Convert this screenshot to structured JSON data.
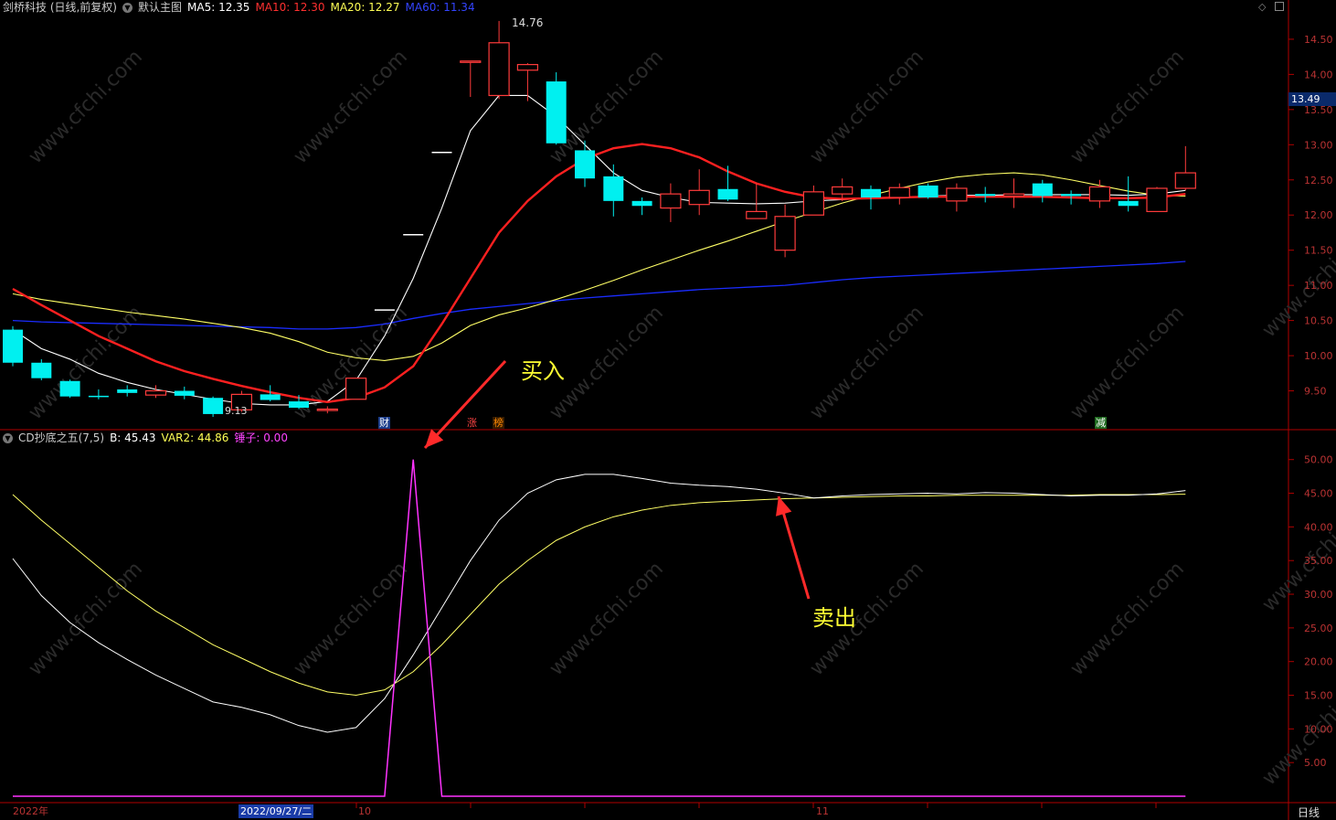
{
  "header_main": {
    "title": "剑桥科技 (日线,前复权)",
    "mode": "默认主图",
    "ma5": "MA5: 12.35",
    "ma10": "MA10: 12.30",
    "ma20": "MA20: 12.27",
    "ma60": "MA60: 11.34"
  },
  "header_sub": {
    "name": "CD抄底之五(7,5)",
    "b": "B: 45.43",
    "var2": "VAR2: 44.86",
    "hammer": "锤子: 0.00"
  },
  "current_price": "13.49",
  "annotations": {
    "buy": "买入",
    "sell": "卖出",
    "high": "14.76",
    "low": "9.13"
  },
  "event_tags": {
    "t1": "财",
    "t2": "涨",
    "t3": "榜",
    "t4": "减"
  },
  "x_axis": {
    "year": "2022年",
    "selected_date": "2022/09/27/二",
    "m10": "10",
    "m11": "11",
    "period": "日线"
  },
  "colors": {
    "up": "#ff3b3b",
    "down": "#00f0f0",
    "ma5": "#ffffff",
    "ma10": "#ff2020",
    "ma20": "#ffff66",
    "ma60": "#1a2cff",
    "b": "#ffffff",
    "var2": "#ffff66",
    "hammer": "#ff33ff",
    "axis": "#b00000"
  },
  "chart_data": [
    {
      "type": "candlestick",
      "title": "剑桥科技 (日线,前复权)",
      "y_ticks": [
        "9.50",
        "10.00",
        "10.50",
        "11.00",
        "11.50",
        "12.00",
        "12.50",
        "13.00",
        "13.50",
        "14.00",
        "14.50"
      ],
      "ylim": [
        9.0,
        14.85
      ],
      "candles": [
        {
          "o": 10.37,
          "h": 10.42,
          "l": 9.85,
          "c": 9.9
        },
        {
          "o": 9.9,
          "h": 9.95,
          "l": 9.65,
          "c": 9.68
        },
        {
          "o": 9.64,
          "h": 9.66,
          "l": 9.4,
          "c": 9.42
        },
        {
          "o": 9.43,
          "h": 9.52,
          "l": 9.38,
          "c": 9.42
        },
        {
          "o": 9.52,
          "h": 9.58,
          "l": 9.42,
          "c": 9.47
        },
        {
          "o": 9.44,
          "h": 9.58,
          "l": 9.4,
          "c": 9.5
        },
        {
          "o": 9.5,
          "h": 9.56,
          "l": 9.38,
          "c": 9.43
        },
        {
          "o": 9.4,
          "h": 9.42,
          "l": 9.13,
          "c": 9.17
        },
        {
          "o": 9.23,
          "h": 9.5,
          "l": 9.2,
          "c": 9.45
        },
        {
          "o": 9.45,
          "h": 9.58,
          "l": 9.35,
          "c": 9.37
        },
        {
          "o": 9.35,
          "h": 9.44,
          "l": 9.24,
          "c": 9.26
        },
        {
          "o": 9.23,
          "h": 9.28,
          "l": 9.18,
          "c": 9.24
        },
        {
          "o": 9.38,
          "h": 9.68,
          "l": 9.38,
          "c": 9.68
        },
        {
          "o": 10.65,
          "h": 10.65,
          "l": 10.65,
          "c": 10.65
        },
        {
          "o": 11.72,
          "h": 11.72,
          "l": 11.72,
          "c": 11.72
        },
        {
          "o": 12.89,
          "h": 12.89,
          "l": 12.89,
          "c": 12.89
        },
        {
          "o": 14.19,
          "h": 14.19,
          "l": 13.68,
          "c": 14.19
        },
        {
          "o": 13.7,
          "h": 14.76,
          "l": 13.65,
          "c": 14.45
        },
        {
          "o": 14.06,
          "h": 14.16,
          "l": 13.62,
          "c": 14.14
        },
        {
          "o": 13.9,
          "h": 14.03,
          "l": 13.0,
          "c": 13.02
        },
        {
          "o": 12.92,
          "h": 13.06,
          "l": 12.4,
          "c": 12.52
        },
        {
          "o": 12.55,
          "h": 12.72,
          "l": 11.98,
          "c": 12.2
        },
        {
          "o": 12.2,
          "h": 12.25,
          "l": 12.0,
          "c": 12.13
        },
        {
          "o": 12.1,
          "h": 12.45,
          "l": 11.9,
          "c": 12.3
        },
        {
          "o": 12.15,
          "h": 12.65,
          "l": 12.0,
          "c": 12.35
        },
        {
          "o": 12.37,
          "h": 12.7,
          "l": 12.2,
          "c": 12.22
        },
        {
          "o": 11.95,
          "h": 12.45,
          "l": 11.95,
          "c": 12.05
        },
        {
          "o": 11.5,
          "h": 12.15,
          "l": 11.4,
          "c": 11.98
        },
        {
          "o": 12.0,
          "h": 12.42,
          "l": 12.0,
          "c": 12.33
        },
        {
          "o": 12.3,
          "h": 12.52,
          "l": 12.2,
          "c": 12.4
        },
        {
          "o": 12.37,
          "h": 12.42,
          "l": 12.08,
          "c": 12.25
        },
        {
          "o": 12.25,
          "h": 12.45,
          "l": 12.15,
          "c": 12.39
        },
        {
          "o": 12.42,
          "h": 12.45,
          "l": 12.23,
          "c": 12.25
        },
        {
          "o": 12.2,
          "h": 12.45,
          "l": 12.05,
          "c": 12.38
        },
        {
          "o": 12.3,
          "h": 12.4,
          "l": 12.18,
          "c": 12.27
        },
        {
          "o": 12.27,
          "h": 12.52,
          "l": 12.1,
          "c": 12.3
        },
        {
          "o": 12.45,
          "h": 12.5,
          "l": 12.18,
          "c": 12.27
        },
        {
          "o": 12.3,
          "h": 12.35,
          "l": 12.15,
          "c": 12.27
        },
        {
          "o": 12.2,
          "h": 12.5,
          "l": 12.1,
          "c": 12.4
        },
        {
          "o": 12.2,
          "h": 12.55,
          "l": 12.05,
          "c": 12.13
        },
        {
          "o": 12.05,
          "h": 12.4,
          "l": 12.05,
          "c": 12.38
        },
        {
          "o": 12.38,
          "h": 12.98,
          "l": 12.35,
          "c": 12.6
        }
      ],
      "ma5": [
        10.37,
        10.1,
        9.95,
        9.75,
        9.62,
        9.52,
        9.45,
        9.38,
        9.32,
        9.3,
        9.3,
        9.35,
        9.65,
        10.28,
        11.1,
        12.1,
        13.2,
        13.7,
        13.7,
        13.4,
        13.0,
        12.6,
        12.35,
        12.25,
        12.18,
        12.17,
        12.16,
        12.17,
        12.2,
        12.22,
        12.24,
        12.25,
        12.27,
        12.28,
        12.28,
        12.29,
        12.29,
        12.29,
        12.29,
        12.28,
        12.3,
        12.35
      ],
      "ma10": [
        10.95,
        10.72,
        10.5,
        10.28,
        10.1,
        9.92,
        9.78,
        9.67,
        9.57,
        9.48,
        9.4,
        9.34,
        9.4,
        9.55,
        9.85,
        10.45,
        11.1,
        11.75,
        12.2,
        12.55,
        12.8,
        12.95,
        13.01,
        12.95,
        12.82,
        12.62,
        12.45,
        12.33,
        12.25,
        12.23,
        12.24,
        12.25,
        12.26,
        12.26,
        12.26,
        12.26,
        12.26,
        12.25,
        12.24,
        12.24,
        12.25,
        12.3
      ],
      "ma20": [
        10.88,
        10.8,
        10.74,
        10.68,
        10.62,
        10.57,
        10.52,
        10.46,
        10.4,
        10.32,
        10.2,
        10.05,
        9.97,
        9.93,
        9.99,
        10.18,
        10.43,
        10.58,
        10.68,
        10.8,
        10.93,
        11.07,
        11.22,
        11.36,
        11.5,
        11.63,
        11.77,
        11.91,
        12.04,
        12.17,
        12.28,
        12.38,
        12.47,
        12.54,
        12.58,
        12.6,
        12.57,
        12.5,
        12.42,
        12.34,
        12.28,
        12.27
      ],
      "ma60": [
        10.5,
        10.48,
        10.47,
        10.46,
        10.45,
        10.44,
        10.43,
        10.42,
        10.41,
        10.4,
        10.38,
        10.38,
        10.4,
        10.45,
        10.53,
        10.6,
        10.66,
        10.7,
        10.74,
        10.78,
        10.82,
        10.85,
        10.88,
        10.91,
        10.94,
        10.96,
        10.98,
        11.0,
        11.04,
        11.08,
        11.11,
        11.13,
        11.15,
        11.17,
        11.19,
        11.21,
        11.23,
        11.25,
        11.27,
        11.29,
        11.31,
        11.34
      ],
      "last_price": 13.49
    },
    {
      "type": "line",
      "title": "CD抄底之五(7,5)",
      "y_ticks": [
        "5.00",
        "10.00",
        "15.00",
        "20.00",
        "25.00",
        "30.00",
        "35.00",
        "40.00",
        "45.00",
        "50.00"
      ],
      "ylim": [
        0,
        52
      ],
      "series": [
        {
          "name": "B",
          "values": [
            35.3,
            29.8,
            25.8,
            22.8,
            20.3,
            18.0,
            16.0,
            14.0,
            13.2,
            12.1,
            10.5,
            9.5,
            10.2,
            14.5,
            21.0,
            28.0,
            35.0,
            41.0,
            45.0,
            47.0,
            47.8,
            47.8,
            47.2,
            46.5,
            46.2,
            46.0,
            45.6,
            45.0,
            44.3,
            44.6,
            44.8,
            44.9,
            45.0,
            44.9,
            45.1,
            45.0,
            44.8,
            44.6,
            44.7,
            44.7,
            44.9,
            45.4
          ]
        },
        {
          "name": "VAR2",
          "values": [
            44.8,
            41.0,
            37.5,
            34.0,
            30.5,
            27.5,
            25.0,
            22.5,
            20.5,
            18.5,
            16.8,
            15.5,
            15.0,
            15.8,
            18.5,
            22.5,
            27.0,
            31.5,
            35.0,
            38.0,
            40.0,
            41.5,
            42.5,
            43.2,
            43.6,
            43.8,
            44.0,
            44.2,
            44.3,
            44.4,
            44.5,
            44.6,
            44.6,
            44.7,
            44.7,
            44.7,
            44.7,
            44.7,
            44.8,
            44.8,
            44.8,
            44.86
          ]
        },
        {
          "name": "锤子",
          "values": [
            0,
            0,
            0,
            0,
            0,
            0,
            0,
            0,
            0,
            0,
            0,
            0,
            0,
            0,
            50,
            0,
            0,
            0,
            0,
            0,
            0,
            0,
            0,
            0,
            0,
            0,
            0,
            0,
            0,
            0,
            0,
            0,
            0,
            0,
            0,
            0,
            0,
            0,
            0,
            0,
            0,
            0
          ]
        }
      ]
    }
  ]
}
